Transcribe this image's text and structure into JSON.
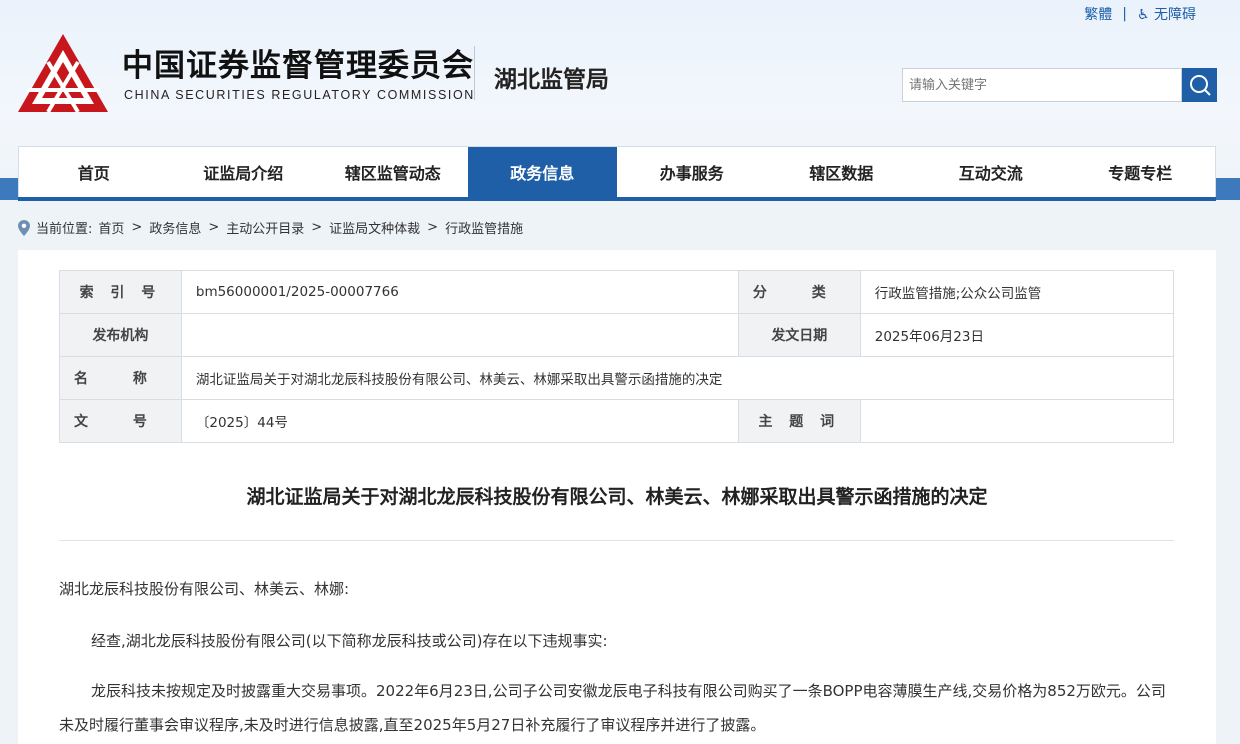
{
  "header": {
    "top_links": {
      "traditional": "繁體",
      "separator": "|",
      "accessibility": "无障碍"
    },
    "org_name_cn": "中国证券监督管理委员会",
    "org_name_en": "CHINA SECURITIES REGULATORY COMMISSION",
    "branch": "湖北监管局",
    "search": {
      "placeholder": "请输入关键字",
      "icon": "search-icon"
    },
    "logo_color": "#c8161d"
  },
  "nav": {
    "items": [
      "首页",
      "证监局介绍",
      "辖区监管动态",
      "政务信息",
      "办事服务",
      "辖区数据",
      "互动交流",
      "专题专栏"
    ],
    "active": "政务信息",
    "accent": "#1e5fa8"
  },
  "breadcrumb": {
    "prefix": "当前位置:",
    "items": [
      "首页",
      "政务信息",
      "主动公开目录",
      "证监局文种体裁",
      "行政监管措施"
    ],
    "separator": ">"
  },
  "meta": {
    "index_label": "索 引 号",
    "index_value": "bm56000001/2025-00007766",
    "category_label": "分 类",
    "category_value": "行政监管措施;公众公司监管",
    "issuer_label": "发布机构",
    "issuer_value": "",
    "date_label": "发文日期",
    "date_value": "2025年06月23日",
    "name_label": "名 称",
    "name_value": "湖北证监局关于对湖北龙辰科技股份有限公司、林美云、林娜采取出具警示函措施的决定",
    "docno_label": "文 号",
    "docno_value": "〔2025〕44号",
    "keywords_label": "主 题 词",
    "keywords_value": ""
  },
  "document": {
    "title": "湖北证监局关于对湖北龙辰科技股份有限公司、林美云、林娜采取出具警示函措施的决定",
    "salutation": "湖北龙辰科技股份有限公司、林美云、林娜:",
    "para1": "经查,湖北龙辰科技股份有限公司(以下简称龙辰科技或公司)存在以下违规事实:",
    "para2": "龙辰科技未按规定及时披露重大交易事项。2022年6月23日,公司子公司安徽龙辰电子科技有限公司购买了一条BOPP电容薄膜生产线,交易价格为852万欧元。公司未及时履行董事会审议程序,未及时进行信息披露,直至2025年5月27日补充履行了审议程序并进行了披露。"
  }
}
